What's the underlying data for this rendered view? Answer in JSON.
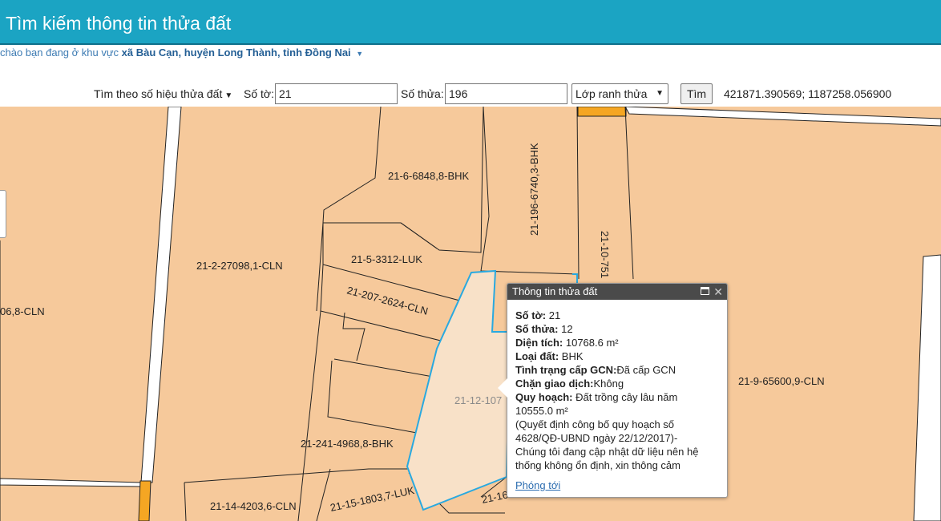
{
  "header": {
    "title": "Tìm kiếm thông tin thửa đất"
  },
  "region": {
    "prefix": "chào bạn đang ở khu vực",
    "location": "xã Bàu Cạn, huyện Long Thành, tỉnh Đồng Nai"
  },
  "search": {
    "mode_label": "Tìm theo số hiệu thửa đất",
    "sheet_label": "Số tờ:",
    "sheet_value": "21",
    "parcel_label": "Số thửa:",
    "parcel_value": "196",
    "layer_label": "Lớp ranh thửa",
    "search_button": "Tìm",
    "coordinates": "421871.390569; 1187258.056900"
  },
  "map": {
    "colors": {
      "parcel_fill": "#f6c99b",
      "parcel_stroke": "#222222",
      "selected_fill": "#f8e1c8",
      "selected_stroke": "#29a9e0",
      "road_fill": "#ffffff",
      "orange_marker": "#f5a623"
    },
    "parcel_labels": [
      "21-6-6848,8-BHK",
      "21-196-6740,3-BHK",
      "21-10-751",
      "21-2-27098,1-CLN",
      "06,8-CLN",
      "21-5-3312-LUK",
      "21-207-2624-CLN",
      "21-12-107",
      "21-241-4968,8-BHK",
      "21-9-65600,9-CLN",
      "21-14-4203,6-CLN",
      "21-15-1803,7-LUK",
      "21-16"
    ]
  },
  "popup": {
    "title": "Thông tin thửa đất",
    "so_to_label": "Số tờ:",
    "so_to_value": "21",
    "so_thua_label": "Số thửa:",
    "so_thua_value": "12",
    "dien_tich_label": "Diện tích:",
    "dien_tich_value": "10768.6 m²",
    "loai_dat_label": "Loại đất:",
    "loai_dat_value": "BHK",
    "tinh_trang_label": "Tình trạng cấp GCN:",
    "tinh_trang_value": "Đã cấp GCN",
    "chan_gd_label": "Chặn giao dịch:",
    "chan_gd_value": "Không",
    "quy_hoach_label": "Quy hoạch:",
    "quy_hoach_value": "Đất trồng cây lâu năm",
    "quy_hoach_area": "10555.0 m²",
    "note_1": "(Quyết định công bố quy hoạch số",
    "note_2": "4628/QĐ-UBND ngày 22/12/2017)-",
    "note_3": "Chúng tôi đang cập nhật dữ liệu nên hệ",
    "note_4": "thống không ổn định, xin thông cảm",
    "zoom_link": "Phóng tới"
  }
}
